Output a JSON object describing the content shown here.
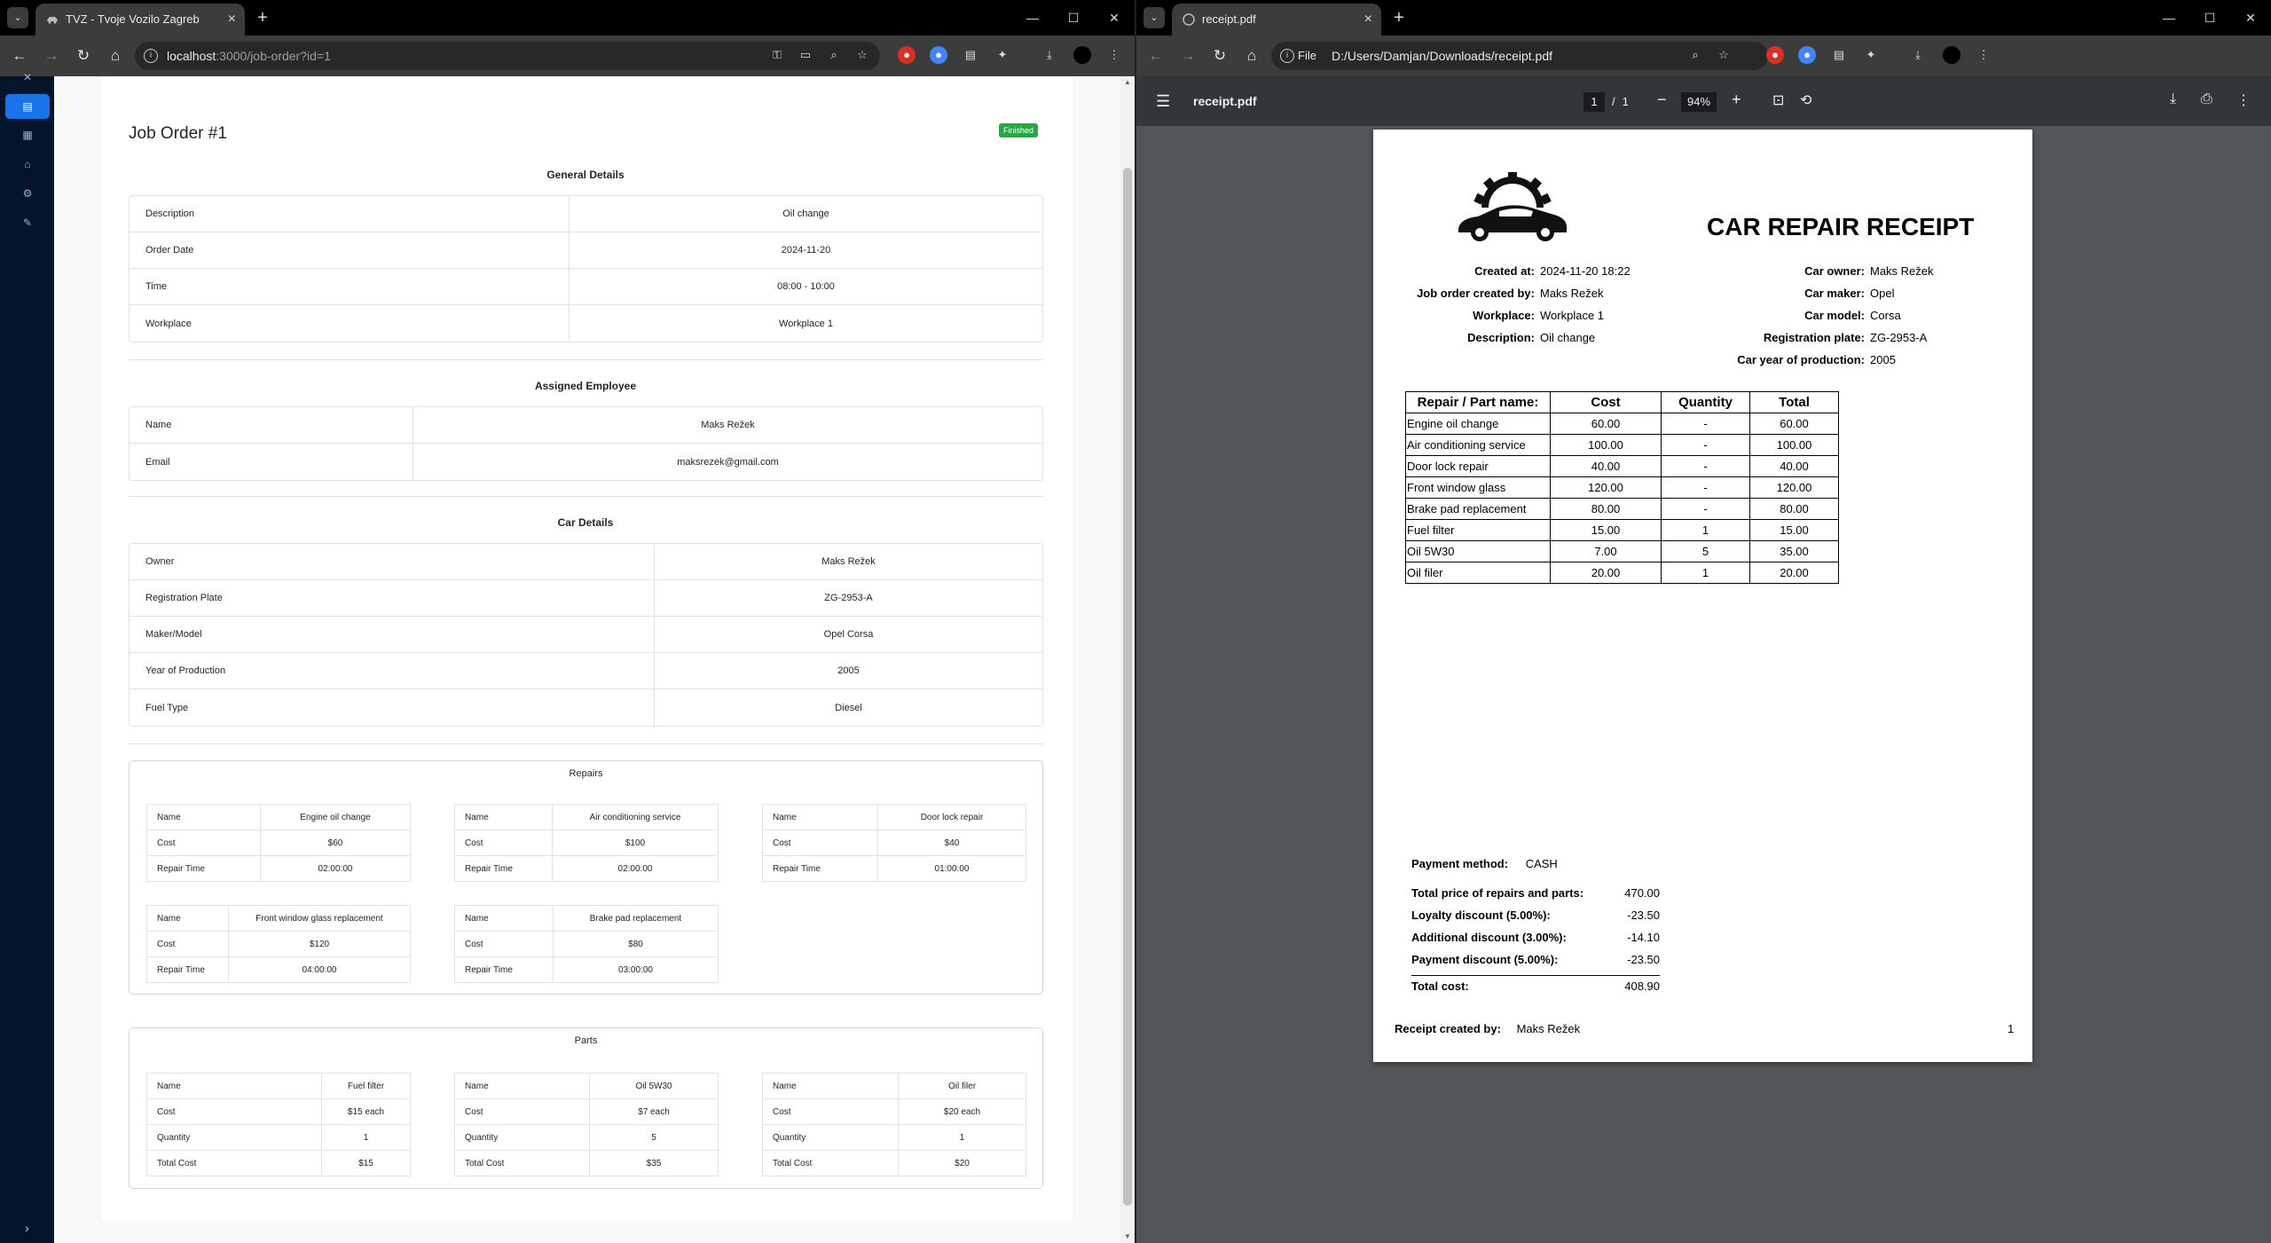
{
  "left_window": {
    "tab_title": "TVZ - Tvoje Vozilo Zagreb",
    "url_host": "localhost",
    "url_path": ":3000/job-order?id=1",
    "page": {
      "title": "Job Order #1",
      "status": "Finished",
      "general": {
        "heading": "General Details",
        "rows": [
          {
            "k": "Description",
            "v": "Oil change"
          },
          {
            "k": "Order Date",
            "v": "2024-11-20"
          },
          {
            "k": "Time",
            "v": "08:00 - 10:00"
          },
          {
            "k": "Workplace",
            "v": "Workplace 1"
          }
        ]
      },
      "employee": {
        "heading": "Assigned Employee",
        "rows": [
          {
            "k": "Name",
            "v": "Maks Režek"
          },
          {
            "k": "Email",
            "v": "maksrezek@gmail.com"
          }
        ]
      },
      "car": {
        "heading": "Car Details",
        "rows": [
          {
            "k": "Owner",
            "v": "Maks Režek"
          },
          {
            "k": "Registration Plate",
            "v": "ZG-2953-A"
          },
          {
            "k": "Maker/Model",
            "v": "Opel Corsa"
          },
          {
            "k": "Year of Production",
            "v": "2005"
          },
          {
            "k": "Fuel Type",
            "v": "Diesel"
          }
        ]
      },
      "repairs": {
        "heading": "Repairs",
        "labels": {
          "name": "Name",
          "cost": "Cost",
          "time": "Repair Time"
        },
        "items": [
          {
            "name": "Engine oil change",
            "cost": "$60",
            "time": "02:00:00"
          },
          {
            "name": "Air conditioning service",
            "cost": "$100",
            "time": "02:00:00"
          },
          {
            "name": "Door lock repair",
            "cost": "$40",
            "time": "01:00:00"
          },
          {
            "name": "Front window glass replacement",
            "cost": "$120",
            "time": "04:00:00"
          },
          {
            "name": "Brake pad replacement",
            "cost": "$80",
            "time": "03:00:00"
          }
        ]
      },
      "parts": {
        "heading": "Parts",
        "labels": {
          "name": "Name",
          "cost": "Cost",
          "qty": "Quantity",
          "total": "Total Cost"
        },
        "items": [
          {
            "name": "Fuel filter",
            "cost": "$15 each",
            "qty": "1",
            "total": "$15"
          },
          {
            "name": "Oil 5W30",
            "cost": "$7 each",
            "qty": "5",
            "total": "$35"
          },
          {
            "name": "Oil filer",
            "cost": "$20 each",
            "qty": "1",
            "total": "$20"
          }
        ]
      }
    }
  },
  "right_window": {
    "tab_title": "receipt.pdf",
    "url_chip": "File",
    "url": "D:/Users/Damjan/Downloads/receipt.pdf",
    "viewer": {
      "file_name": "receipt.pdf",
      "page_current": "1",
      "page_sep": "/",
      "page_total": "1",
      "zoom": "94%"
    },
    "receipt": {
      "title": "CAR REPAIR RECEIPT",
      "left_meta": [
        {
          "k": "Created at:",
          "v": "2024-11-20 18:22"
        },
        {
          "k": "Job order created by:",
          "v": "Maks Režek"
        },
        {
          "k": "Workplace:",
          "v": "Workplace 1"
        },
        {
          "k": "Description:",
          "v": "Oil change"
        }
      ],
      "right_meta": [
        {
          "k": "Car owner:",
          "v": "Maks Režek"
        },
        {
          "k": "Car maker:",
          "v": "Opel"
        },
        {
          "k": "Car model:",
          "v": "Corsa"
        },
        {
          "k": "Registration plate:",
          "v": "ZG-2953-A"
        },
        {
          "k": "Car year of production:",
          "v": "2005"
        }
      ],
      "table_headers": [
        "Repair / Part name:",
        "Cost",
        "Quantity",
        "Total"
      ],
      "table_rows": [
        [
          "Engine oil change",
          "60.00",
          "-",
          "60.00"
        ],
        [
          "Air conditioning service",
          "100.00",
          "-",
          "100.00"
        ],
        [
          "Door lock repair",
          "40.00",
          "-",
          "40.00"
        ],
        [
          "Front window glass",
          "120.00",
          "-",
          "120.00"
        ],
        [
          "Brake pad replacement",
          "80.00",
          "-",
          "80.00"
        ],
        [
          "Fuel filter",
          "15.00",
          "1",
          "15.00"
        ],
        [
          "Oil 5W30",
          "7.00",
          "5",
          "35.00"
        ],
        [
          "Oil filer",
          "20.00",
          "1",
          "20.00"
        ]
      ],
      "payment_label": "Payment method:",
      "payment_value": "CASH",
      "summary": [
        {
          "k": "Total price of repairs and parts:",
          "v": "470.00"
        },
        {
          "k": "Loyalty discount (5.00%):",
          "v": "-23.50"
        },
        {
          "k": "Additional discount (3.00%):",
          "v": "-14.10"
        },
        {
          "k": "Payment discount (5.00%):",
          "v": "-23.50"
        }
      ],
      "total": {
        "k": "Total cost:",
        "v": "408.90"
      },
      "footer_label": "Receipt created by:",
      "footer_value": "Maks Režek",
      "page_number": "1"
    }
  }
}
